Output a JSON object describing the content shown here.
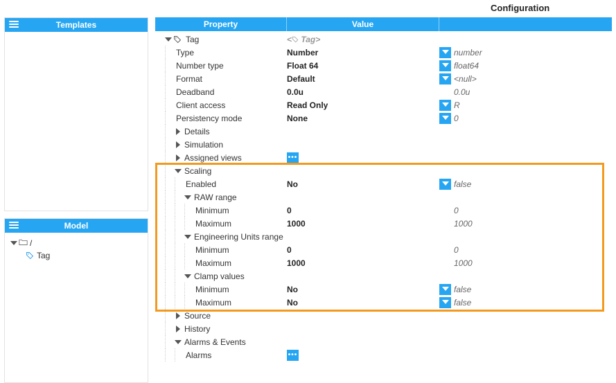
{
  "title": "Configuration",
  "panels": {
    "templates": "Templates",
    "model": "Model"
  },
  "columns": {
    "property": "Property",
    "value": "Value"
  },
  "model_tree": {
    "root": "/",
    "items": [
      "Tag"
    ]
  },
  "tag": {
    "header": "Tag",
    "header_value": "<​◎​ Tag>",
    "rows": {
      "type": {
        "label": "Type",
        "value": "Number",
        "ext": "number"
      },
      "number_type": {
        "label": "Number type",
        "value": "Float 64",
        "ext": "float64"
      },
      "format": {
        "label": "Format",
        "value": "Default",
        "ext": "<null>"
      },
      "deadband": {
        "label": "Deadband",
        "value": "0.0u",
        "ext": "0.0u"
      },
      "client_access": {
        "label": "Client access",
        "value": "Read Only",
        "ext": "R"
      },
      "persistency": {
        "label": "Persistency mode",
        "value": "None",
        "ext": "0"
      },
      "details": {
        "label": "Details"
      },
      "simulation": {
        "label": "Simulation"
      },
      "assigned_views": {
        "label": "Assigned views"
      },
      "scaling": {
        "label": "Scaling",
        "enabled": {
          "label": "Enabled",
          "value": "No",
          "ext": "false"
        },
        "raw": {
          "label": "RAW range",
          "min": {
            "label": "Minimum",
            "value": "0",
            "ext": "0"
          },
          "max": {
            "label": "Maximum",
            "value": "1000",
            "ext": "1000"
          }
        },
        "eu": {
          "label": "Engineering Units range",
          "min": {
            "label": "Minimum",
            "value": "0",
            "ext": "0"
          },
          "max": {
            "label": "Maximum",
            "value": "1000",
            "ext": "1000"
          }
        },
        "clamp": {
          "label": "Clamp values",
          "min": {
            "label": "Minimum",
            "value": "No",
            "ext": "false"
          },
          "max": {
            "label": "Maximum",
            "value": "No",
            "ext": "false"
          }
        }
      },
      "source": {
        "label": "Source"
      },
      "history": {
        "label": "History"
      },
      "alarms_events": {
        "label": "Alarms & Events",
        "alarms": {
          "label": "Alarms"
        }
      }
    }
  }
}
